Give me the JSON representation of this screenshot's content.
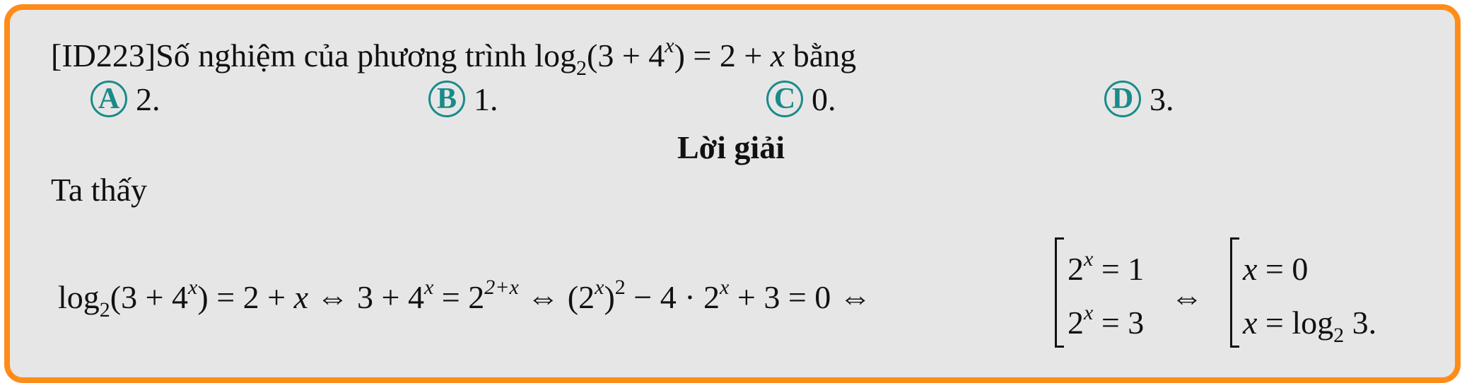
{
  "question": {
    "id": "[ID223]",
    "text_before": "Số nghiệm của phương trình ",
    "log": "log",
    "base": "2",
    "open": "(3 + 4",
    "exp": "x",
    "close": ") = 2 + ",
    "var": "x",
    "text_after": " bằng"
  },
  "choices": [
    {
      "letter": "A",
      "value": "2."
    },
    {
      "letter": "B",
      "value": "1."
    },
    {
      "letter": "C",
      "value": "0."
    },
    {
      "letter": "D",
      "value": "3."
    }
  ],
  "solution": {
    "heading": "Lời giải",
    "intro": "Ta thấy",
    "line": {
      "p1_log": "log",
      "p1_base": "2",
      "p1_open": "(3 + 4",
      "p1_exp": "x",
      "p1_close": ") = 2 + ",
      "p1_var": "x",
      "iff": " ⇔ ",
      "p2": "3 + 4",
      "p2_exp": "x",
      "p2_eq": " = 2",
      "p2_exp2": "2+x",
      "p3_open": "(2",
      "p3_exp": "x",
      "p3_close": ")",
      "p3_sq": "2",
      "p3_rest": " − 4 · 2",
      "p3_exp2": "x",
      "p3_end": " + 3 = 0",
      "sys1_r1_base": "2",
      "sys1_r1_exp": "x",
      "sys1_r1_rhs": " = 1",
      "sys1_r2_base": "2",
      "sys1_r2_exp": "x",
      "sys1_r2_rhs": " = 3",
      "sys2_r1_var": "x",
      "sys2_r1_rhs": " = 0",
      "sys2_r2_var": "x",
      "sys2_r2_eq": " = log",
      "sys2_r2_base": "2",
      "sys2_r2_end": " 3."
    }
  },
  "colors": {
    "border": "#ff8c1a",
    "background": "#e6e6e6",
    "badge": "#1a8a8a"
  }
}
